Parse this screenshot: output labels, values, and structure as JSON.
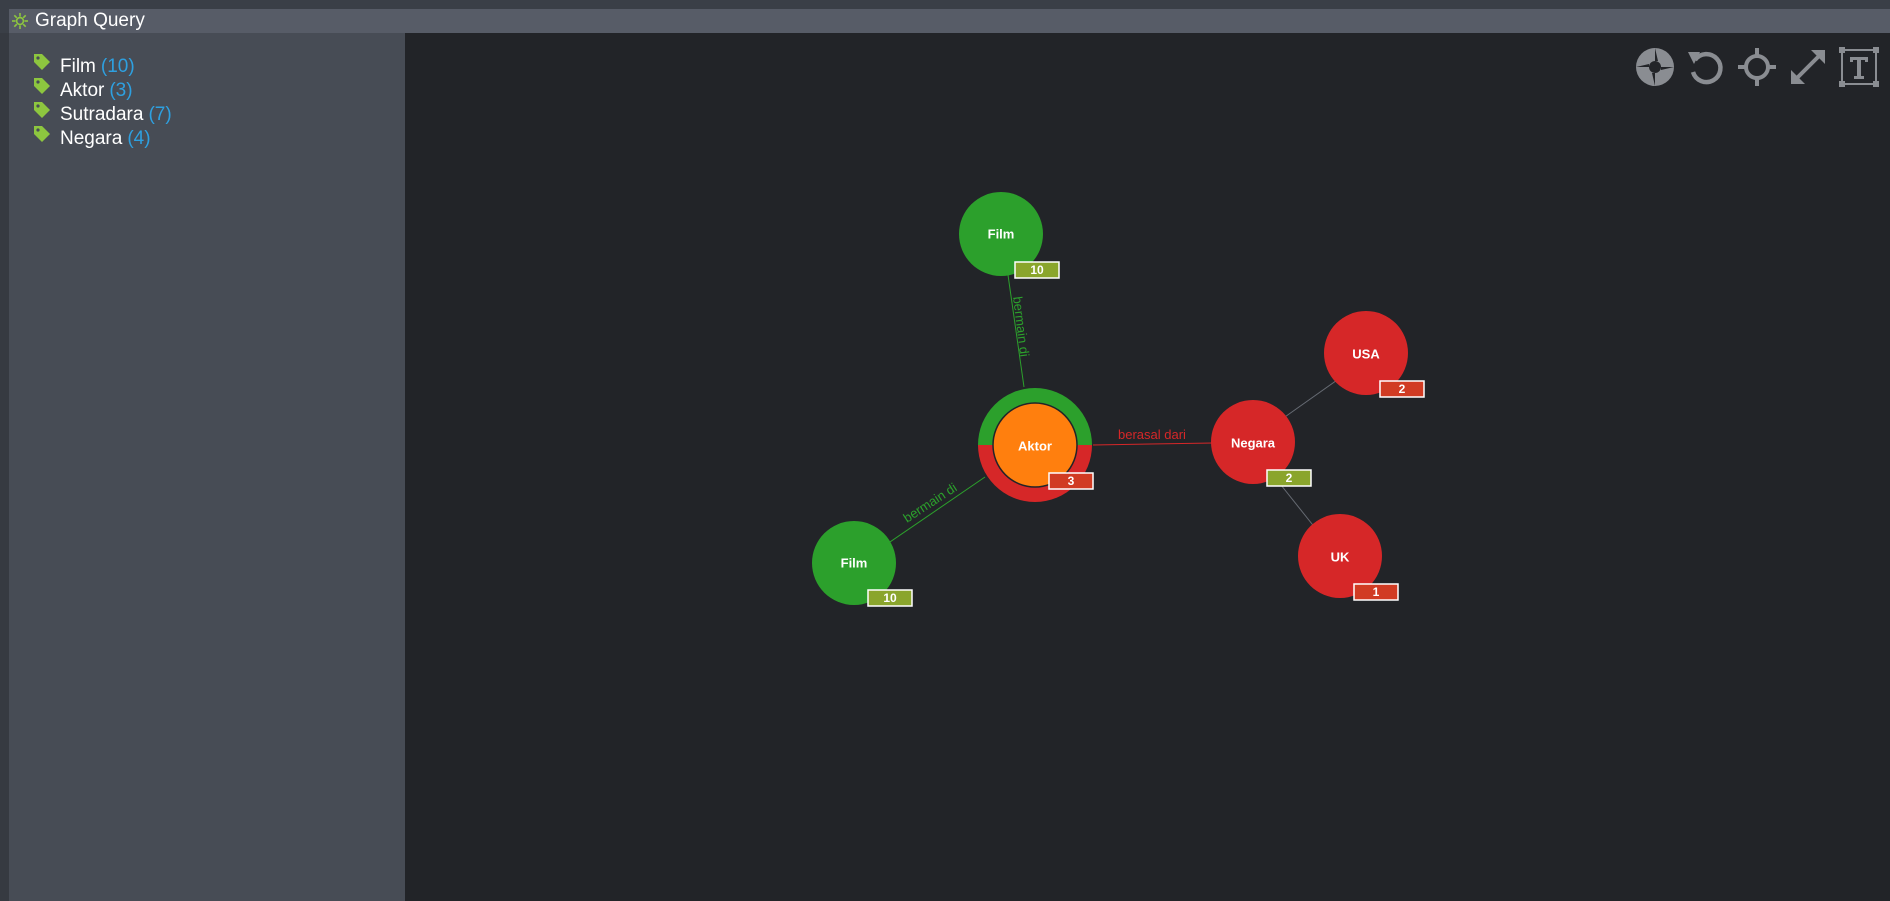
{
  "window": {
    "title": "Graph Query"
  },
  "sidebar": {
    "labels": [
      {
        "name": "Film",
        "count": "(10)"
      },
      {
        "name": "Aktor",
        "count": "(3)"
      },
      {
        "name": "Sutradara",
        "count": "(7)"
      },
      {
        "name": "Negara",
        "count": "(4)"
      }
    ]
  },
  "toolbar": {
    "icons": [
      "shutter-icon",
      "undo-icon",
      "crosshair-icon",
      "fullscreen-icon",
      "text-toggle-icon"
    ]
  },
  "colors": {
    "film": "#2ca02c",
    "aktor": "#ff7f0e",
    "negara": "#d62728",
    "badge_green": "#8aa52c",
    "badge_red": "#d13b23",
    "count_blue": "#2ea0e0",
    "tag_green": "#8dc63f"
  },
  "graph": {
    "nodes": {
      "film_top": {
        "label": "Film",
        "badge": "10"
      },
      "film_left": {
        "label": "Film",
        "badge": "10"
      },
      "aktor": {
        "label": "Aktor",
        "badge": "3"
      },
      "negara": {
        "label": "Negara",
        "badge": "2"
      },
      "usa": {
        "label": "USA",
        "badge": "2"
      },
      "uk": {
        "label": "UK",
        "badge": "1"
      }
    },
    "edges": {
      "aktor_film_top": "bermain di",
      "aktor_film_left": "bermain di",
      "aktor_negara": "berasal dari"
    }
  }
}
